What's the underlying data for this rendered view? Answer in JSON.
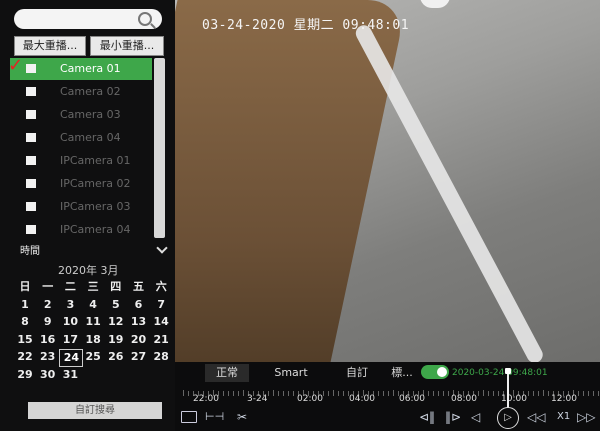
{
  "left_panel": {
    "search": {
      "placeholder": ""
    },
    "buttons": {
      "max_replay": "最大重播...",
      "min_replay": "最小重播..."
    },
    "cameras": [
      {
        "label": "Camera 01",
        "selected": true
      },
      {
        "label": "Camera 02",
        "selected": false
      },
      {
        "label": "Camera 03",
        "selected": false
      },
      {
        "label": "Camera 04",
        "selected": false
      },
      {
        "label": "IPCamera 01",
        "selected": false
      },
      {
        "label": "IPCamera 02",
        "selected": false
      },
      {
        "label": "IPCamera 03",
        "selected": false
      },
      {
        "label": "IPCamera 04",
        "selected": false
      }
    ],
    "time_section": "時間",
    "calendar": {
      "month_label": "2020年 3月",
      "weekdays": [
        "日",
        "一",
        "二",
        "三",
        "四",
        "五",
        "六"
      ],
      "weeks": [
        [
          "1",
          "2",
          "3",
          "4",
          "5",
          "6",
          "7"
        ],
        [
          "8",
          "9",
          "10",
          "11",
          "12",
          "13",
          "14"
        ],
        [
          "15",
          "16",
          "17",
          "18",
          "19",
          "20",
          "21"
        ],
        [
          "22",
          "23",
          "24",
          "25",
          "26",
          "27",
          "28"
        ],
        [
          "29",
          "30",
          "31",
          "",
          "",
          "",
          ""
        ]
      ],
      "today": "24"
    },
    "custom_search": "自訂搜尋"
  },
  "video": {
    "osd": "03-24-2020 星期二 09:48:01"
  },
  "bottom_bar": {
    "tabs": [
      "正常",
      "Smart",
      "自訂",
      "標..."
    ],
    "active_tab": 0,
    "timestamp": "2020-03-24 09:48:01",
    "timeline_labels": [
      "22:00",
      "3-24",
      "02:00",
      "04:00",
      "06:00",
      "08:00",
      "10:00",
      "12:00"
    ],
    "controls": {
      "frame": "⊲‖",
      "step": "‖⊳",
      "back": "◁",
      "play": "▷",
      "slow": "◁◁",
      "speed": "X1",
      "fast": "▷▷"
    }
  },
  "colors": {
    "accent_green": "#3ea74a",
    "check_red": "#e52222"
  }
}
